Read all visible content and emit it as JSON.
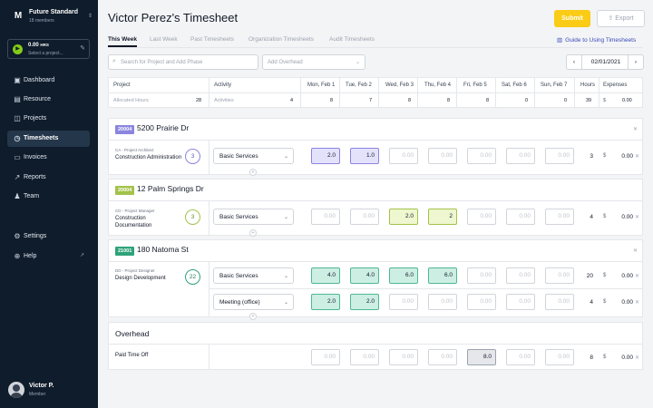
{
  "org": {
    "name": "Future Standard",
    "members": "18 members",
    "logo": "M"
  },
  "timer": {
    "hours": "0.00",
    "hours_unit": "HRS",
    "select_label": "Select a project..."
  },
  "nav": [
    {
      "label": "Dashboard",
      "icon": "dashboard-icon"
    },
    {
      "label": "Resource",
      "icon": "resource-icon"
    },
    {
      "label": "Projects",
      "icon": "projects-icon"
    },
    {
      "label": "Timesheets",
      "icon": "clock-icon",
      "active": true
    },
    {
      "label": "Invoices",
      "icon": "invoice-icon"
    },
    {
      "label": "Reports",
      "icon": "reports-icon"
    },
    {
      "label": "Team",
      "icon": "team-icon"
    },
    {
      "label": "Settings",
      "icon": "gear-icon"
    },
    {
      "label": "Help",
      "icon": "help-icon"
    }
  ],
  "user": {
    "name": "Victor P.",
    "role": "Member"
  },
  "page": {
    "title": "Victor Perez's Timesheet",
    "submit": "Submit",
    "export": "Export"
  },
  "tabs": [
    "This Week",
    "Last Week",
    "Past Timesheets",
    "Organization Timesheets",
    "Audit Timesheets"
  ],
  "guide_link": "Guide to Using Timesheets",
  "search": {
    "placeholder": "Search for Project and Add Phase"
  },
  "overhead_select": {
    "placeholder": "Add Overhead"
  },
  "date": "02/01/2021",
  "columns": {
    "project": "Project",
    "activity": "Activity",
    "days": [
      "Mon, Feb 1",
      "Tue, Feb 2",
      "Wed, Feb 3",
      "Thu, Feb 4",
      "Fri, Feb 5",
      "Sat, Feb 6",
      "Sun, Feb 7"
    ],
    "hours": "Hours",
    "expenses": "Expenses"
  },
  "summary": {
    "allocated_label": "Allocated Hours",
    "allocated": "28",
    "activities_label": "Activities",
    "activities": "4",
    "days": [
      "8",
      "7",
      "8",
      "8",
      "8",
      "0",
      "0"
    ],
    "hours": "39",
    "currency": "$",
    "expenses": "0.00"
  },
  "projects": [
    {
      "code": "20004",
      "name": "5200 Prairie Dr",
      "color": "#8b85e0",
      "phases": [
        {
          "role": "CA - Project Architect",
          "name": "Construction Administration",
          "count": "3",
          "ring": "#8b85e0",
          "rows": [
            {
              "activity": "Basic Services",
              "cells": [
                "2.0",
                "1.0",
                "0.00",
                "0.00",
                "0.00",
                "0.00",
                "0.00"
              ],
              "hours": "3",
              "currency": "$",
              "expense": "0.00"
            }
          ]
        }
      ]
    },
    {
      "code": "20004",
      "name": "12 Palm Springs Dr",
      "color": "#a3c24a",
      "phases": [
        {
          "role": "CD - Project Manager",
          "name": "Construction Documentation",
          "count": "3",
          "ring": "#a3c24a",
          "rows": [
            {
              "activity": "Basic Services",
              "cells": [
                "0.00",
                "0.00",
                "2.0",
                "2",
                "0.00",
                "0.00",
                "0.00"
              ],
              "hours": "4",
              "currency": "$",
              "expense": "0.00"
            }
          ]
        }
      ]
    },
    {
      "code": "21001",
      "name": "180 Natoma St",
      "color": "#2fa37a",
      "phases": [
        {
          "role": "DD - Project Designer",
          "name": "Design Development",
          "count": "22",
          "ring": "#2fa37a",
          "rows": [
            {
              "activity": "Basic Services",
              "cells": [
                "4.0",
                "4.0",
                "6.0",
                "6.0",
                "0.00",
                "0.00",
                "0.00"
              ],
              "hours": "20",
              "currency": "$",
              "expense": "0.00"
            },
            {
              "activity": "Meeting (office)",
              "cells": [
                "2.0",
                "2.0",
                "0.00",
                "0.00",
                "0.00",
                "0.00",
                "0.00"
              ],
              "hours": "4",
              "currency": "$",
              "expense": "0.00"
            }
          ]
        }
      ]
    }
  ],
  "overhead": {
    "title": "Overhead",
    "item": "Paid Time Off",
    "cells": [
      "0.00",
      "0.00",
      "0.00",
      "0.00",
      "8.0",
      "0.00",
      "0.00"
    ],
    "hours": "8",
    "currency": "$",
    "expense": "0.00"
  }
}
